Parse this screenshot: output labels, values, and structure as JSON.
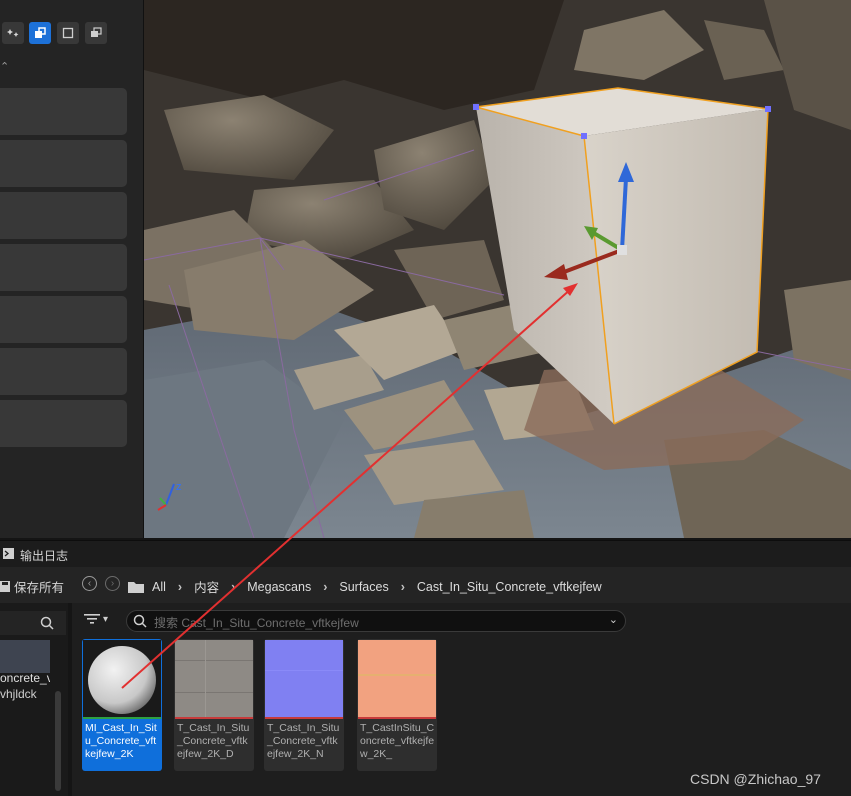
{
  "log": {
    "label": "输出日志"
  },
  "toolbar": {
    "save_all": "保存所有"
  },
  "breadcrumb": [
    "All",
    "内容",
    "Megascans",
    "Surfaces",
    "Cast_In_Situ_Concrete_vftkejfew"
  ],
  "search": {
    "placeholder": "搜索 Cast_In_Situ_Concrete_vftkejfew"
  },
  "sources": {
    "items": [
      "oncrete_v",
      "vhjldck"
    ]
  },
  "assets": [
    {
      "name": "MI_Cast_In_Situ_Concrete_vftkejfew_2K",
      "stripe_color": "#2ea043",
      "selected": true
    },
    {
      "name": "T_Cast_In_Situ_Concrete_vftkejfew_2K_D",
      "stripe_color": "#c73b3b",
      "selected": false
    },
    {
      "name": "T_Cast_In_Situ_Concrete_vftkejfew_2K_N",
      "stripe_color": "#c73b3b",
      "selected": false
    },
    {
      "name": "T_CastInSitu_Concrete_vftkejfew_2K_",
      "stripe_color": "#c73b3b",
      "selected": false
    }
  ],
  "viewport": {
    "axis_z": "z"
  },
  "watermark": "CSDN @Zhichao_97",
  "colors": {
    "accent": "#1d71d8",
    "selection_outline": "#f0a020",
    "annotation_arrow": "#e23030"
  }
}
